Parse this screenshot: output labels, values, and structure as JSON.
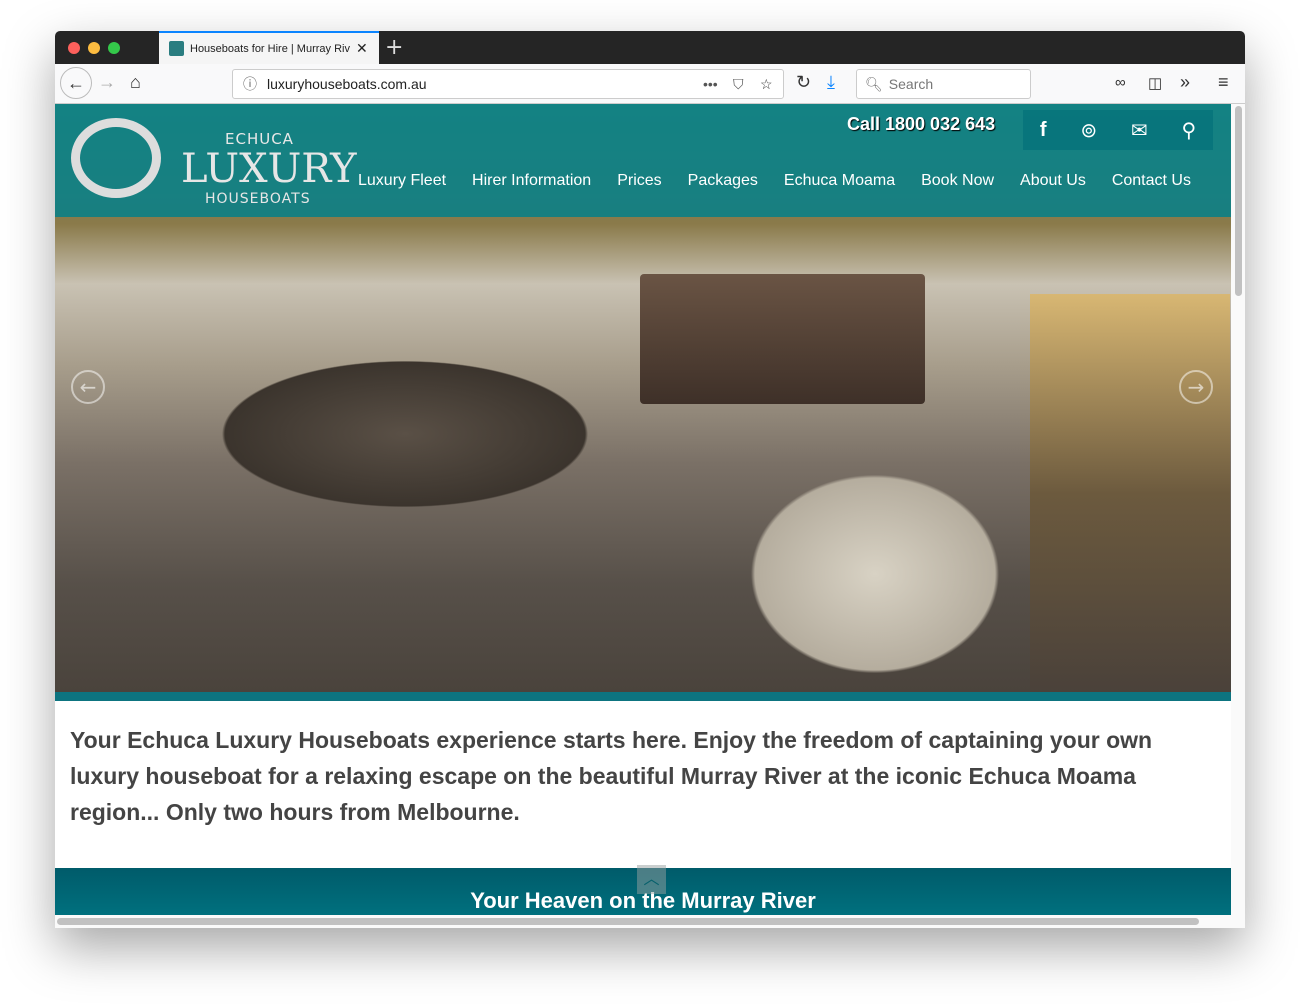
{
  "browser": {
    "tab_title": "Houseboats for Hire | Murray River",
    "url": "luxuryhouseboats.com.au",
    "search_placeholder": "Search"
  },
  "header": {
    "logo": {
      "line1": "ECHUCA",
      "line2": "LUXURY",
      "line3": "HOUSEBOATS"
    },
    "call": "Call 1800 032 643",
    "nav": [
      "Luxury Fleet",
      "Hirer Information",
      "Prices",
      "Packages",
      "Echuca Moama",
      "Book Now",
      "About Us",
      "Contact Us"
    ]
  },
  "main": {
    "intro": "Your Echuca Luxury Houseboats experience starts here. Enjoy the freedom of captaining your own luxury houseboat for a relaxing escape on the beautiful Murray River at the iconic Echuca Moama region... Only two hours from Melbourne.",
    "section_title": "Your Heaven on the Murray River"
  },
  "colors": {
    "brand_teal": "#00808c",
    "dark_teal": "#005b6a"
  }
}
